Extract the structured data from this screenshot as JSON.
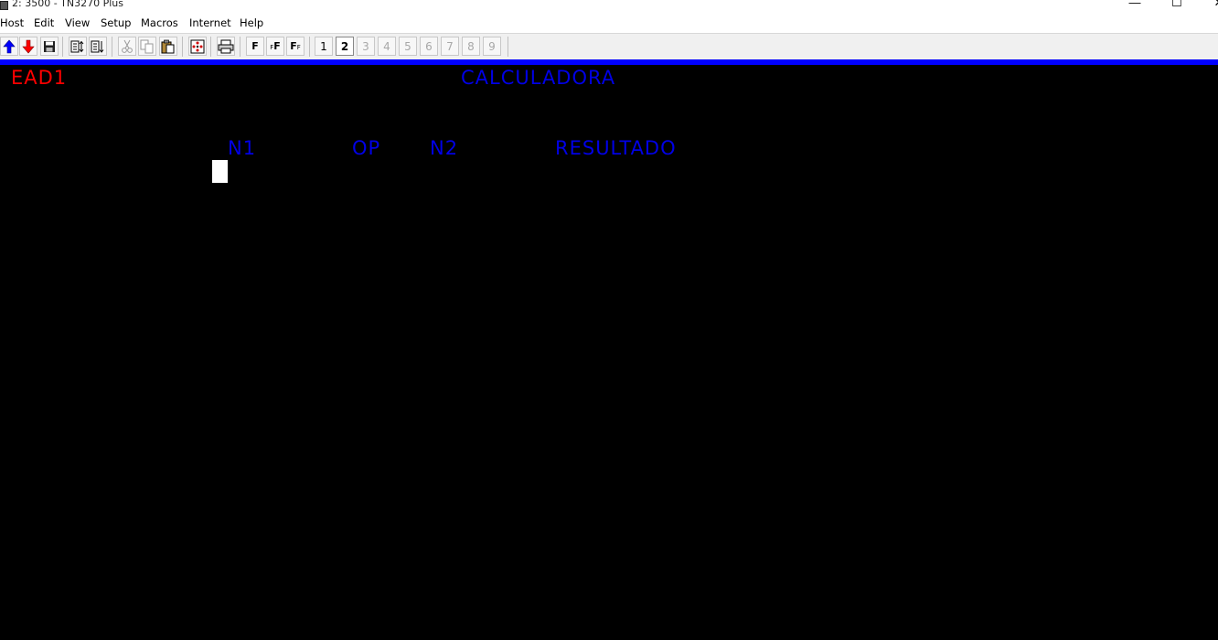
{
  "window": {
    "title": "2: 3500 - TN3270 Plus",
    "controls": {
      "minimize_glyph": "—",
      "maximize_glyph": "☐",
      "close_glyph": "✕"
    }
  },
  "menubar": {
    "items": [
      {
        "label": "Host"
      },
      {
        "label": "Edit"
      },
      {
        "label": "View"
      },
      {
        "label": "Setup"
      },
      {
        "label": "Macros"
      },
      {
        "label": "Internet"
      },
      {
        "label": "Help"
      }
    ]
  },
  "toolbar": {
    "session_buttons": [
      {
        "label": "1",
        "state": "enabled"
      },
      {
        "label": "2",
        "state": "active"
      },
      {
        "label": "3",
        "state": "disabled"
      },
      {
        "label": "4",
        "state": "disabled"
      },
      {
        "label": "5",
        "state": "disabled"
      },
      {
        "label": "6",
        "state": "disabled"
      },
      {
        "label": "7",
        "state": "disabled"
      },
      {
        "label": "8",
        "state": "disabled"
      },
      {
        "label": "9",
        "state": "disabled"
      }
    ],
    "font_buttons": [
      {
        "label": "F"
      },
      {
        "label": "F",
        "small": "F"
      },
      {
        "label": "F",
        "small": "F"
      }
    ],
    "icons": [
      "upload-arrow-icon",
      "download-arrow-icon",
      "save-icon",
      "send-file-icon",
      "receive-file-icon",
      "cut-icon",
      "copy-icon",
      "paste-icon",
      "keypad-icon",
      "print-icon"
    ]
  },
  "terminal": {
    "program_id": "EAD1",
    "screen_title": "CALCULADORA",
    "headers": {
      "n1": "N1",
      "op": "OP",
      "n2": "N2",
      "resultado": "RESULTADO"
    }
  },
  "colors": {
    "background": "#000000",
    "field_red": "#ff0000",
    "field_blue": "#0000e6",
    "divider_blue": "#0000ff",
    "cursor": "#ffffff"
  }
}
